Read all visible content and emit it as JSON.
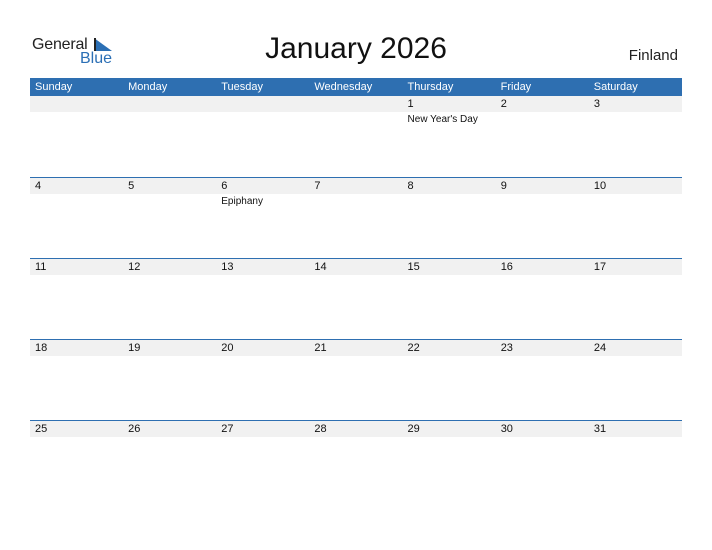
{
  "logo": {
    "word1": "General",
    "word2": "Blue",
    "icon": "triangle-flag-icon",
    "accent": "#2b6fb5"
  },
  "title": "January 2026",
  "country": "Finland",
  "colors": {
    "header_bg": "#2e6fb1",
    "band": "#f1f1f1"
  },
  "weekdays": [
    "Sunday",
    "Monday",
    "Tuesday",
    "Wednesday",
    "Thursday",
    "Friday",
    "Saturday"
  ],
  "weeks": [
    [
      {
        "d": ""
      },
      {
        "d": ""
      },
      {
        "d": ""
      },
      {
        "d": ""
      },
      {
        "d": "1",
        "e": "New Year's Day"
      },
      {
        "d": "2"
      },
      {
        "d": "3"
      }
    ],
    [
      {
        "d": "4"
      },
      {
        "d": "5"
      },
      {
        "d": "6",
        "e": "Epiphany"
      },
      {
        "d": "7"
      },
      {
        "d": "8"
      },
      {
        "d": "9"
      },
      {
        "d": "10"
      }
    ],
    [
      {
        "d": "11"
      },
      {
        "d": "12"
      },
      {
        "d": "13"
      },
      {
        "d": "14"
      },
      {
        "d": "15"
      },
      {
        "d": "16"
      },
      {
        "d": "17"
      }
    ],
    [
      {
        "d": "18"
      },
      {
        "d": "19"
      },
      {
        "d": "20"
      },
      {
        "d": "21"
      },
      {
        "d": "22"
      },
      {
        "d": "23"
      },
      {
        "d": "24"
      }
    ],
    [
      {
        "d": "25"
      },
      {
        "d": "26"
      },
      {
        "d": "27"
      },
      {
        "d": "28"
      },
      {
        "d": "29"
      },
      {
        "d": "30"
      },
      {
        "d": "31"
      }
    ]
  ]
}
